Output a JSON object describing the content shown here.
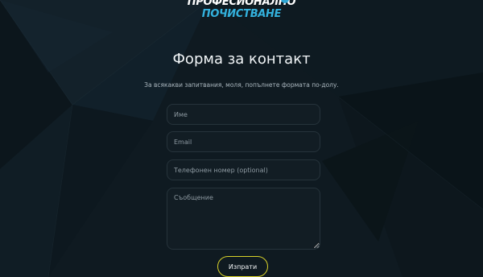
{
  "logo": {
    "line1": "ПРОФЕСИОНАЛНО",
    "line2": "ПОЧИСТВАНЕ"
  },
  "contact": {
    "title": "Форма за контакт",
    "subtitle": "За всякакви запитвания, моля, попълнете формата по-долу.",
    "name_placeholder": "Име",
    "email_placeholder": "Email",
    "phone_placeholder": "Телефонен номер (optional)",
    "message_placeholder": "Съобщение",
    "submit_label": "Изпрати"
  },
  "colors": {
    "background": "#0f1a21",
    "logo_accent": "#33b1dd",
    "button_border": "#d8d22a",
    "field_border": "#26333b"
  }
}
